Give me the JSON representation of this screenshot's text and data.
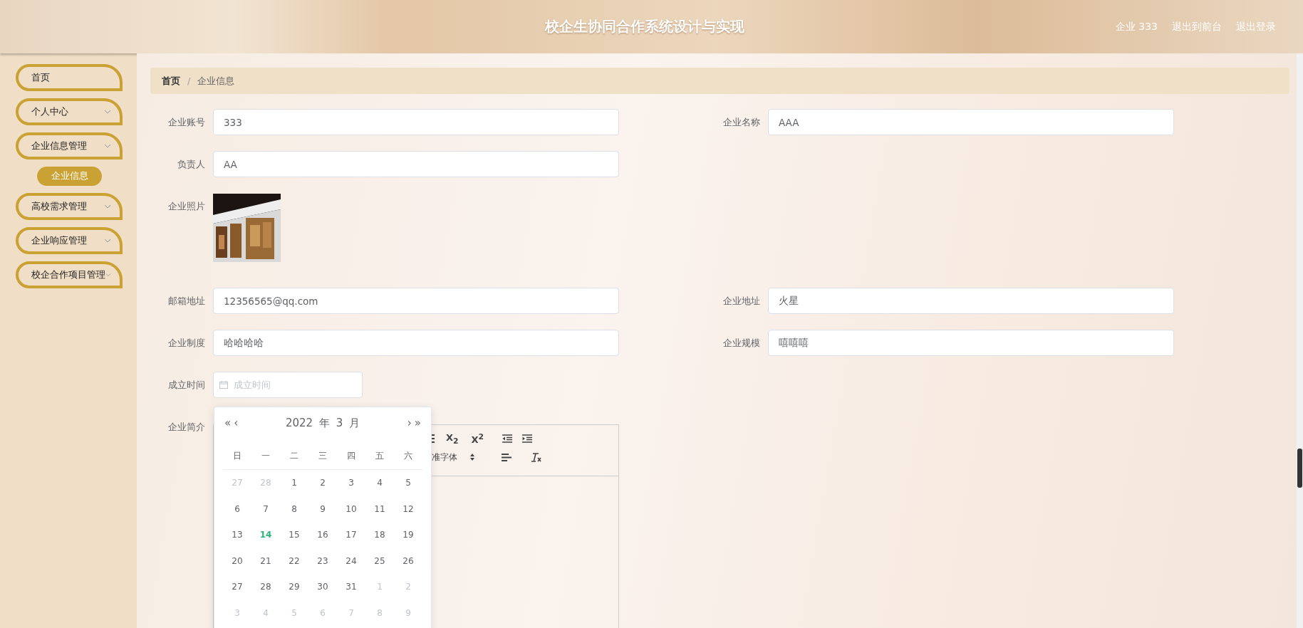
{
  "header": {
    "title": "校企生协同合作系统设计与实现",
    "user": "企业 333",
    "links": [
      "退出到前台",
      "退出登录"
    ]
  },
  "sidebar": {
    "items": [
      {
        "label": "首页",
        "expandable": false
      },
      {
        "label": "个人中心",
        "expandable": true
      },
      {
        "label": "企业信息管理",
        "expandable": true,
        "children": [
          {
            "label": "企业信息",
            "selected": true
          }
        ]
      },
      {
        "label": "高校需求管理",
        "expandable": true
      },
      {
        "label": "企业响应管理",
        "expandable": true
      },
      {
        "label": "校企合作项目管理",
        "expandable": true
      }
    ]
  },
  "breadcrumb": [
    "首页",
    "企业信息"
  ],
  "breadcrumb_separator": "/",
  "form": {
    "rows": [
      [
        {
          "kind": "text",
          "label": "企业账号",
          "value": "333"
        },
        {
          "kind": "text",
          "label": "企业名称",
          "value": "AAA"
        }
      ],
      [
        {
          "kind": "text",
          "label": "负责人",
          "value": "AA"
        }
      ],
      [
        {
          "kind": "picture",
          "label": "企业照片"
        }
      ],
      [
        {
          "kind": "text",
          "label": "邮箱地址",
          "value": "12356565@qq.com"
        },
        {
          "kind": "text",
          "label": "企业地址",
          "value": "火星"
        }
      ],
      [
        {
          "kind": "text",
          "label": "企业制度",
          "value": "哈哈哈哈"
        },
        {
          "kind": "text",
          "label": "企业规模",
          "value": "嘻嘻嘻"
        }
      ],
      [
        {
          "kind": "date",
          "label": "成立时间",
          "placeholder": "成立时间"
        }
      ],
      [
        {
          "kind": "editor",
          "label": "企业简介"
        }
      ]
    ]
  },
  "editor_toolbar": {
    "row_1": [
      "X$_{2}$",
      "X$^{2}$"
    ],
    "font_select": "准字体"
  },
  "date_picker": {
    "prev_year": "«",
    "prev_month": "‹",
    "year": "2022 年",
    "month": "3 月",
    "next_month": "›",
    "next_year": "»",
    "weekdays": [
      "日",
      "一",
      "二",
      "三",
      "四",
      "五",
      "六"
    ],
    "days": [
      {
        "label": "27",
        "kind": "other"
      },
      {
        "label": "28",
        "kind": "other"
      },
      {
        "label": "1",
        "kind": "current"
      },
      {
        "label": "2",
        "kind": "current"
      },
      {
        "label": "3",
        "kind": "current"
      },
      {
        "label": "4",
        "kind": "current"
      },
      {
        "label": "5",
        "kind": "current"
      },
      {
        "label": "6",
        "kind": "current"
      },
      {
        "label": "7",
        "kind": "current"
      },
      {
        "label": "8",
        "kind": "current"
      },
      {
        "label": "9",
        "kind": "current"
      },
      {
        "label": "10",
        "kind": "current"
      },
      {
        "label": "11",
        "kind": "current"
      },
      {
        "label": "12",
        "kind": "current"
      },
      {
        "label": "13",
        "kind": "current"
      },
      {
        "label": "14",
        "kind": "today"
      },
      {
        "label": "15",
        "kind": "current"
      },
      {
        "label": "16",
        "kind": "current"
      },
      {
        "label": "17",
        "kind": "current"
      },
      {
        "label": "18",
        "kind": "current"
      },
      {
        "label": "19",
        "kind": "current"
      },
      {
        "label": "20",
        "kind": "current"
      },
      {
        "label": "21",
        "kind": "current"
      },
      {
        "label": "22",
        "kind": "current"
      },
      {
        "label": "23",
        "kind": "current"
      },
      {
        "label": "24",
        "kind": "current"
      },
      {
        "label": "25",
        "kind": "current"
      },
      {
        "label": "26",
        "kind": "current"
      },
      {
        "label": "27",
        "kind": "current"
      },
      {
        "label": "28",
        "kind": "current"
      },
      {
        "label": "29",
        "kind": "current"
      },
      {
        "label": "30",
        "kind": "current"
      },
      {
        "label": "31",
        "kind": "current"
      },
      {
        "label": "1",
        "kind": "other"
      },
      {
        "label": "2",
        "kind": "other"
      },
      {
        "label": "3",
        "kind": "other"
      },
      {
        "label": "4",
        "kind": "other"
      },
      {
        "label": "5",
        "kind": "other"
      },
      {
        "label": "6",
        "kind": "other"
      },
      {
        "label": "7",
        "kind": "other"
      },
      {
        "label": "8",
        "kind": "other"
      },
      {
        "label": "9",
        "kind": "other"
      }
    ]
  }
}
